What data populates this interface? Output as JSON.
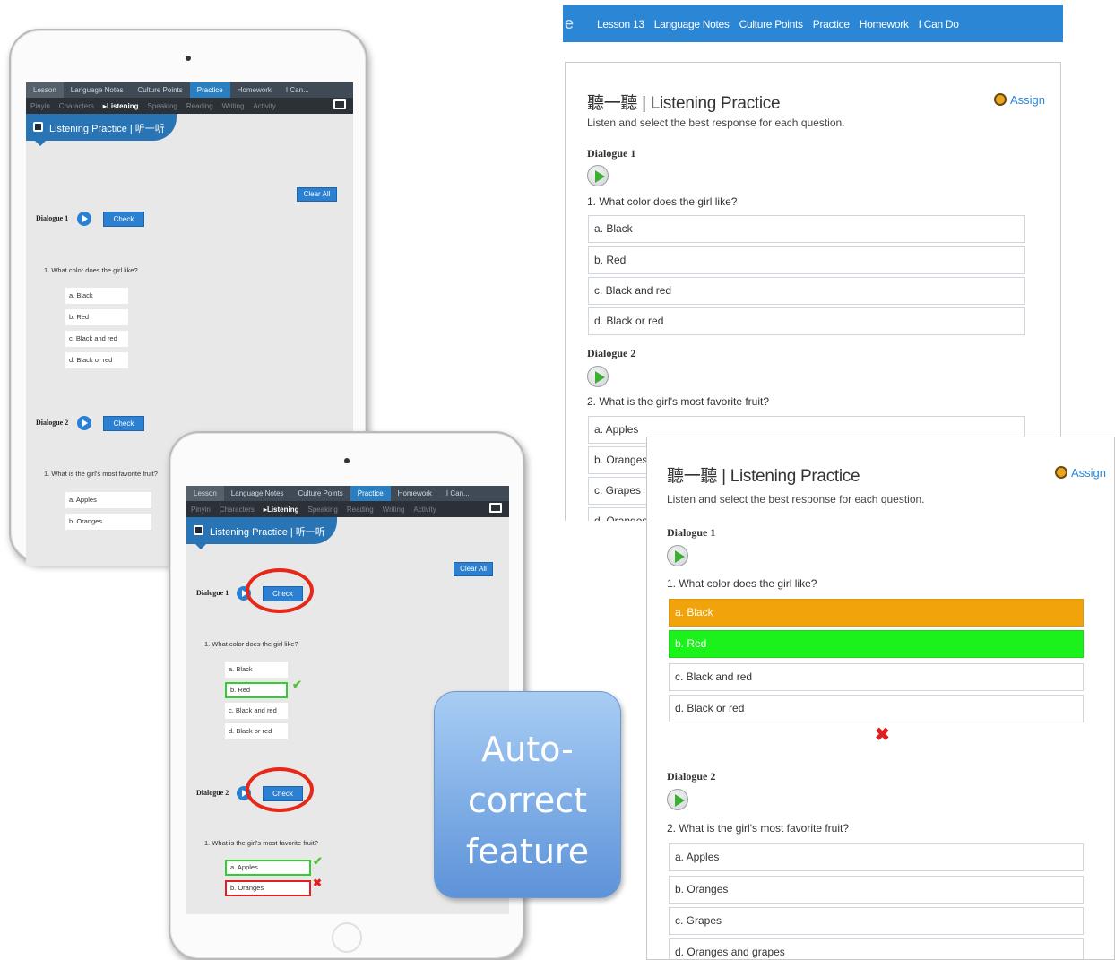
{
  "ipad_menu": {
    "main_tabs": [
      "Lesson",
      "Language Notes",
      "Culture Points",
      "Practice",
      "Homework",
      "I Can..."
    ],
    "sub_tabs": [
      "Pinyin",
      "Characters",
      "▸Listening",
      "Speaking",
      "Reading",
      "Writing",
      "Activity"
    ],
    "section_title": "Listening Practice | 听一听",
    "clear_all": "Clear All",
    "check": "Check",
    "dialogue1": "Dialogue 1",
    "dialogue2": "Dialogue 2",
    "q1": "1.  What color does the girl like?",
    "q1_options": [
      "a. Black",
      "b. Red",
      "c. Black and red",
      "d. Black or red"
    ],
    "q2": "1.  What is the girl's most favorite fruit?",
    "q2_options": [
      "a. Apples",
      "b. Oranges"
    ]
  },
  "web_nav": {
    "logo": "e",
    "items": [
      "Lesson 13",
      "Language Notes",
      "Culture Points",
      "Practice",
      "Homework",
      "I Can Do"
    ]
  },
  "web_page": {
    "title": "聽一聽 | Listening Practice",
    "instructions": "Listen and select the best response for each question.",
    "assign": "Assign",
    "dialogue1": "Dialogue 1",
    "dialogue2": "Dialogue 2",
    "q1": "1. What color does the girl like?",
    "q1_options": [
      "a. Black",
      "b. Red",
      "c. Black and red",
      "d. Black or red"
    ],
    "q2": "2. What is the girl's most favorite fruit?",
    "q2_options": [
      "a. Apples",
      "b. Oranges",
      "c. Grapes",
      "d. Oranges and grapes"
    ],
    "q2_option_cut": "d. Oranges"
  },
  "callout": {
    "text": "Auto-correct feature"
  },
  "colors": {
    "selected_wrong": "#f0a30a",
    "correct": "#1bf21b",
    "nav_blue": "#2b86d6",
    "highlight_red": "#e52817"
  }
}
